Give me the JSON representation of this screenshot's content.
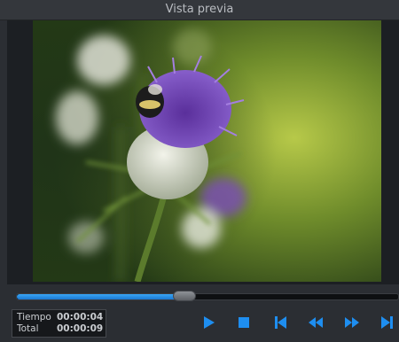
{
  "window": {
    "title": "Vista previa"
  },
  "playback": {
    "progress": 0.44,
    "time_label": "Tiempo",
    "time_value": "00:00:04",
    "total_label": "Total",
    "total_value": "00:00:09"
  },
  "controls": [
    {
      "name": "play-icon"
    },
    {
      "name": "stop-icon"
    },
    {
      "name": "skip-to-start-icon"
    },
    {
      "name": "rewind-icon"
    },
    {
      "name": "fast-forward-icon"
    },
    {
      "name": "skip-to-end-icon"
    }
  ],
  "colors": {
    "accent": "#1e8ef0",
    "background": "#2b2e33",
    "title_text": "#b9bcc1"
  }
}
